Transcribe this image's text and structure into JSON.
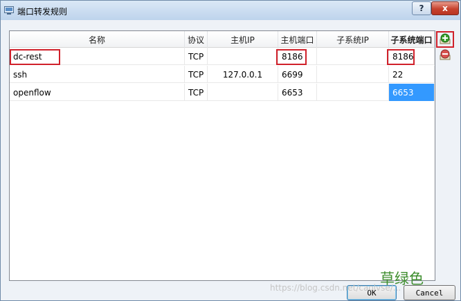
{
  "window": {
    "title": "端口转发规则",
    "help_label": "?",
    "close_label": "x"
  },
  "table": {
    "columns": [
      "名称",
      "协议",
      "主机IP",
      "主机端口",
      "子系统IP",
      "子系统端口"
    ],
    "rows": [
      {
        "name": "dc-rest",
        "protocol": "TCP",
        "host_ip": "",
        "host_port": "8186",
        "guest_ip": "",
        "guest_port": "8186"
      },
      {
        "name": "ssh",
        "protocol": "TCP",
        "host_ip": "127.0.0.1",
        "host_port": "6699",
        "guest_ip": "",
        "guest_port": "22"
      },
      {
        "name": "openflow",
        "protocol": "TCP",
        "host_ip": "",
        "host_port": "6653",
        "guest_ip": "",
        "guest_port": "6653"
      }
    ],
    "selected_cell": {
      "row": 2,
      "column": "子系统端口"
    }
  },
  "sidebar": {
    "add_icon": "add-rule-icon",
    "remove_icon": "remove-rule-icon"
  },
  "buttons": {
    "ok_label": "OK",
    "cancel_label": "Cancel"
  },
  "watermark": {
    "cn": "草绿色",
    "url": "https://blog.csdn.net/caolvse/..."
  },
  "colors": {
    "highlight": "#d0202a",
    "selection": "#3399ff",
    "add_green": "#3aa02c"
  }
}
